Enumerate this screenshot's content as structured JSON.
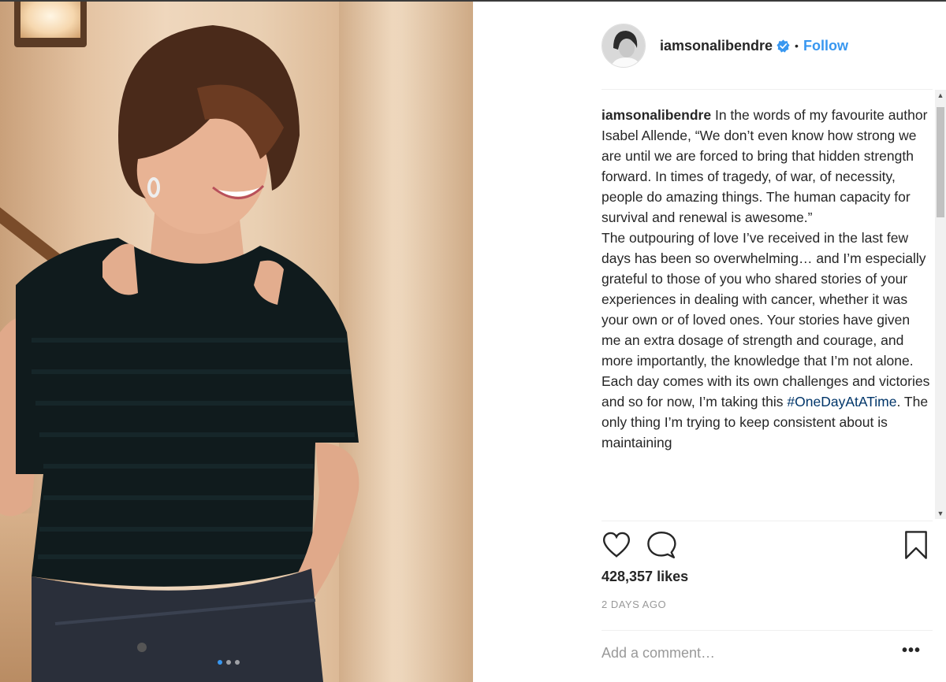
{
  "post": {
    "author": {
      "username": "iamsonalibendre",
      "verified": true,
      "follow_label": "Follow",
      "separator": "•"
    },
    "photo": {
      "carousel_dots": 3,
      "active_dot": 1
    },
    "caption": {
      "username": "iamsonalibendre",
      "lines": [
        "In the words of my favourite author Isabel Allende, “We don’t even know how strong we are until we are forced to bring that hidden strength forward. In times of tragedy, of war, of necessity, people do amazing things. The human capacity for survival and renewal is awesome.”",
        "The outpouring of love I’ve received in the last few days has been so overwhelming… and I’m especially grateful to those of you who shared stories of your experiences in dealing with cancer, whether it was your own or of loved ones. Your stories have given me an extra dosage of strength and courage, and more importantly, the knowledge that I’m not alone."
      ],
      "last_before": "Each day comes with its own challenges and victories and so for now, I’m taking this ",
      "hashtag": "#OneDayAtATime",
      "last_after": ". The only thing I’m trying to keep consistent about is maintaining"
    },
    "likes": "428,357 likes",
    "time_ago": "2 DAYS AGO",
    "comment_placeholder": "Add a comment…",
    "more_label": "•••"
  },
  "icons": [
    "heart-icon",
    "comment-icon",
    "bookmark-icon",
    "verified-badge-icon"
  ],
  "colors": {
    "link_blue": "#3897f0",
    "hashtag": "#003569",
    "muted": "#999999",
    "text": "#262626"
  }
}
